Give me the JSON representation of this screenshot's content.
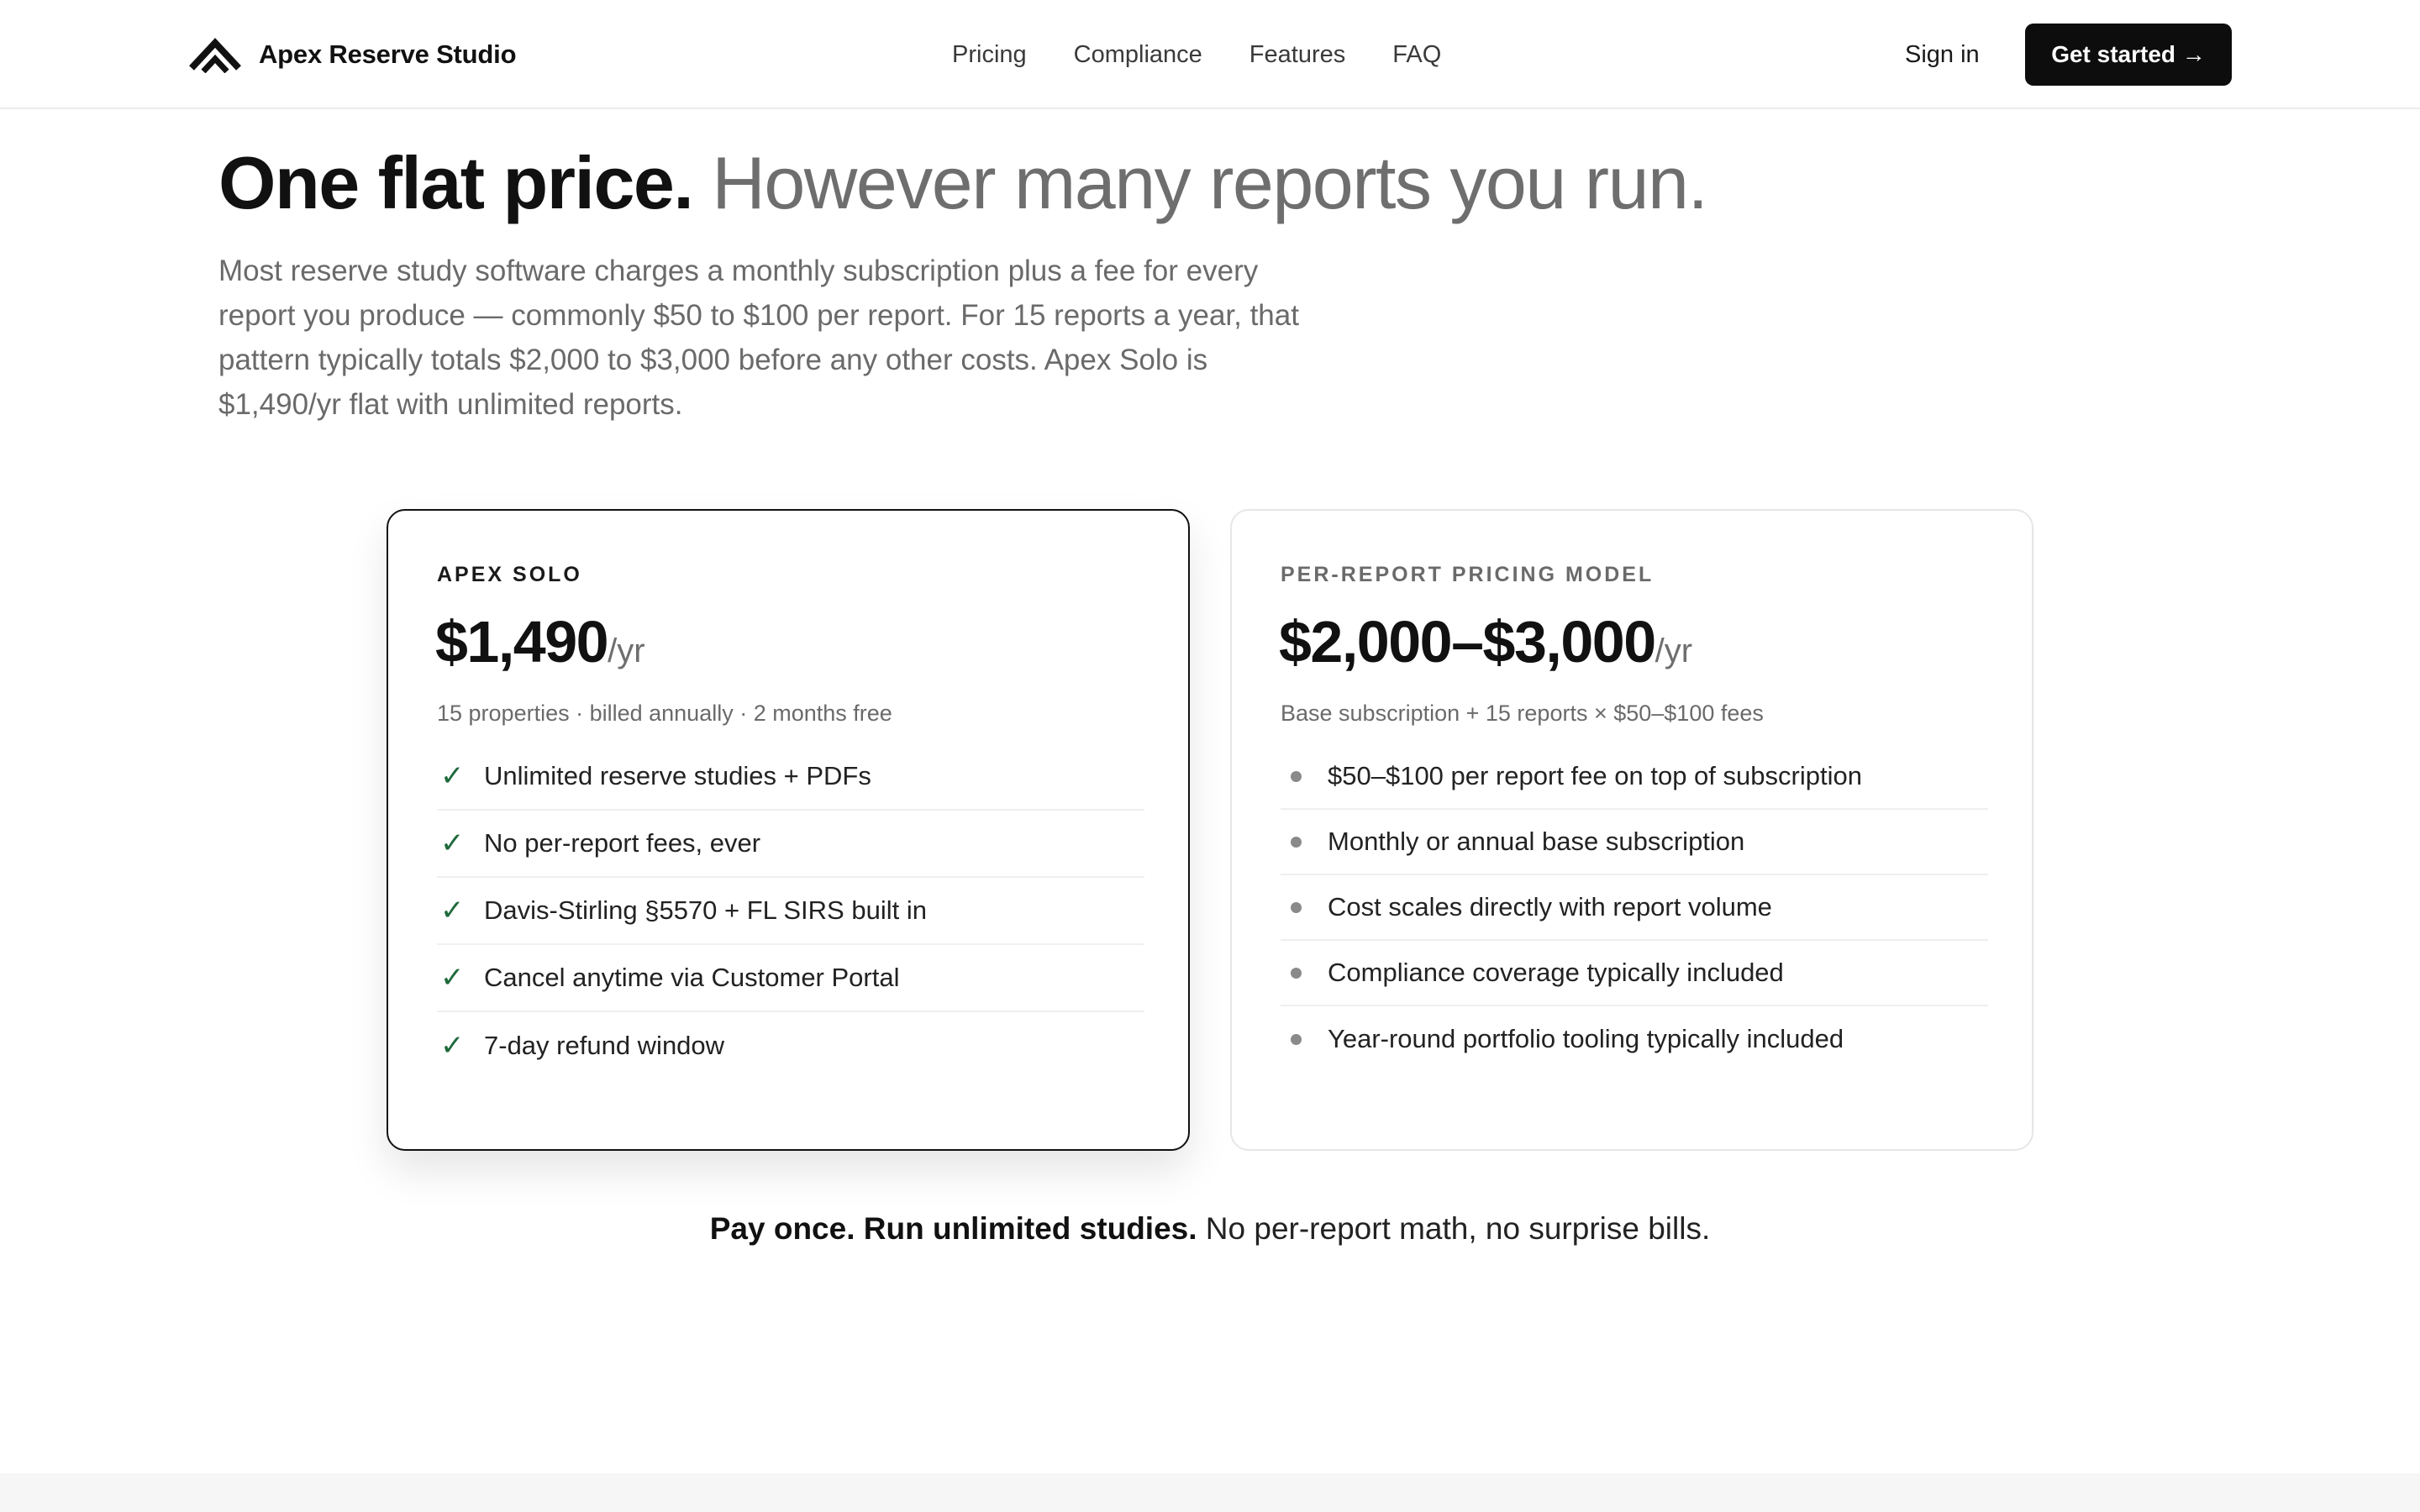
{
  "header": {
    "brand_name": "Apex Reserve Studio",
    "nav": [
      {
        "label": "Pricing"
      },
      {
        "label": "Compliance"
      },
      {
        "label": "Features"
      },
      {
        "label": "FAQ"
      }
    ],
    "signin_label": "Sign in",
    "cta_label": "Get started →"
  },
  "hero": {
    "title_strong": "One flat price.",
    "title_muted": "However many reports you run.",
    "lede": "Most reserve study software charges a monthly subscription plus a fee for every report you produce — commonly $50 to $100 per report. For 15 reports a year, that pattern typically totals $2,000 to $3,000 before any other costs. Apex Solo is $1,490/yr flat with unlimited reports."
  },
  "plans": {
    "solo": {
      "label": "APEX SOLO",
      "price": "$1,490",
      "unit": "/yr",
      "sub": "15 properties · billed annually · 2 months free",
      "check_glyph": "✓",
      "features": [
        "Unlimited reserve studies + PDFs",
        "No per-report fees, ever",
        "Davis-Stirling §5570 + FL SIRS built in",
        "Cancel anytime via Customer Portal",
        "7-day refund window"
      ]
    },
    "per_report": {
      "label": "PER-REPORT PRICING MODEL",
      "price": "$2,000–$3,000",
      "unit": "/yr",
      "sub": "Base subscription + 15 reports × $50–$100 fees",
      "features": [
        "$50–$100 per report fee on top of subscription",
        "Monthly or annual base subscription",
        "Cost scales directly with report volume",
        "Compliance coverage typically included",
        "Year-round portfolio tooling typically included"
      ]
    }
  },
  "tagline": {
    "bold": "Pay once. Run unlimited studies.",
    "rest": " No per-report math, no surprise bills."
  },
  "colors": {
    "accent": "#0d0d0d",
    "check": "#1f6a3c",
    "muted_text": "#6e6e6e"
  },
  "icons": {
    "logo": "apex-chevron-logo",
    "check": "check-icon",
    "bullet": "dot-icon"
  }
}
